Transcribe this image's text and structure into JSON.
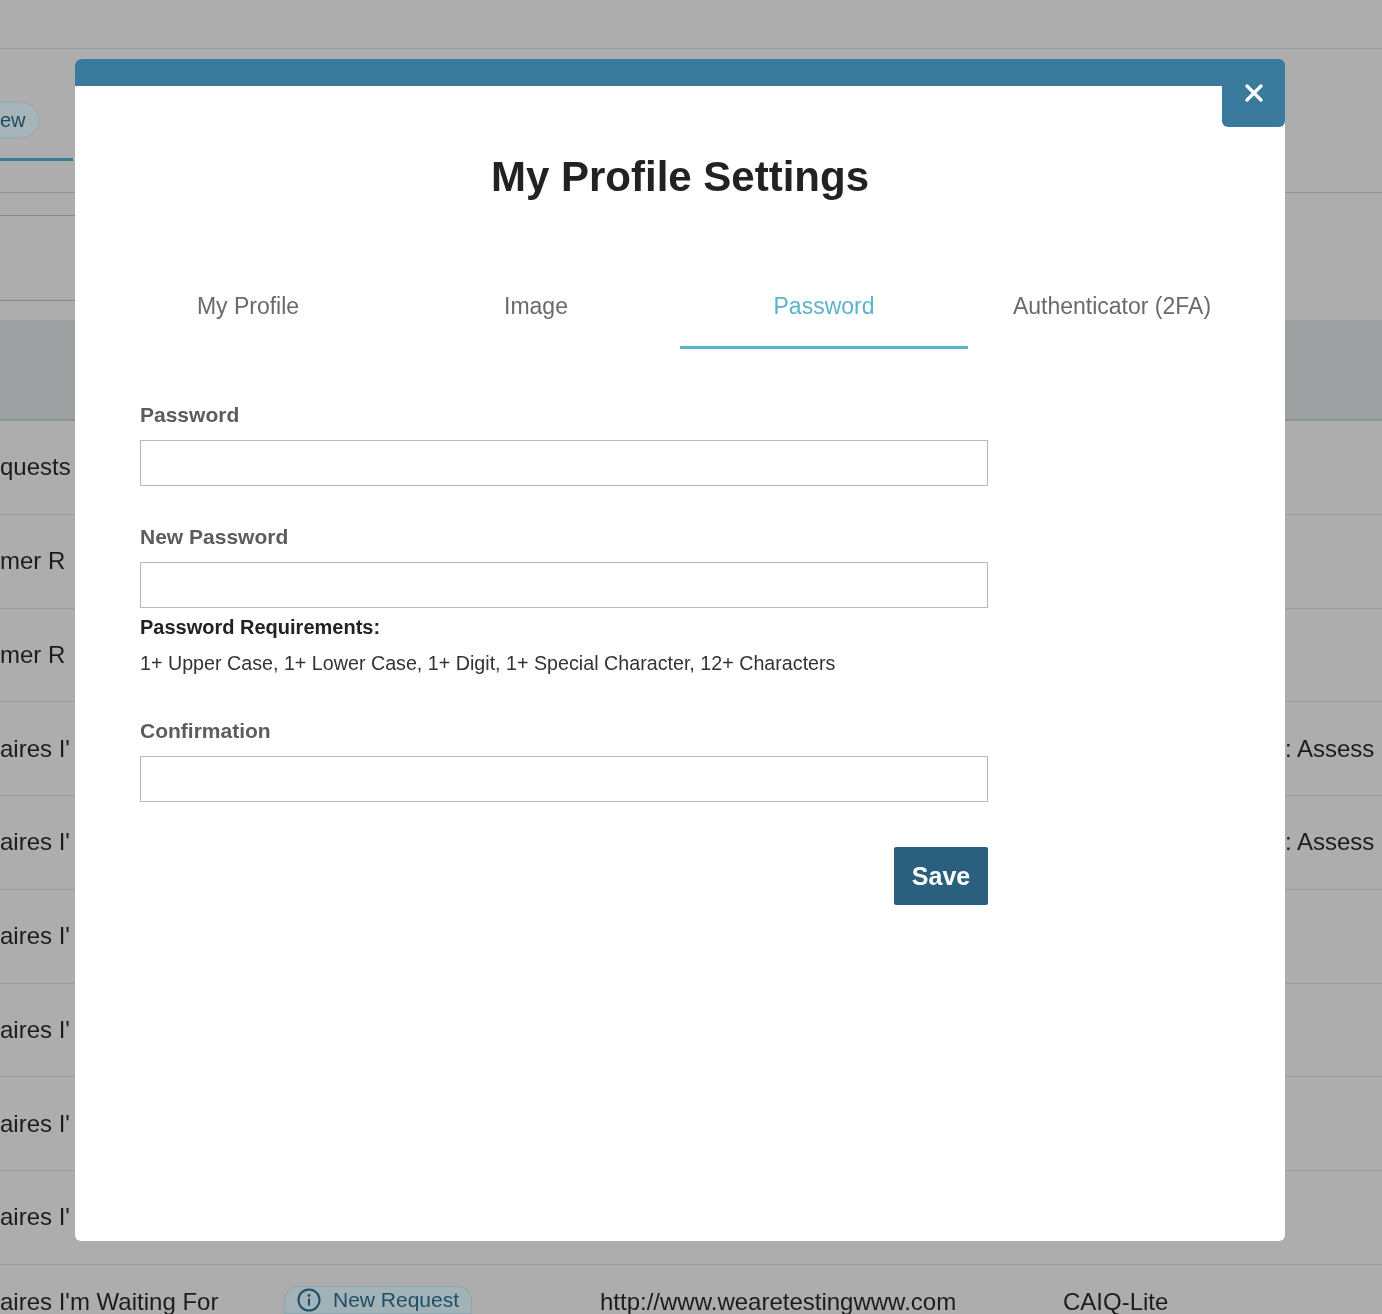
{
  "background": {
    "nav": {
      "pill": "ew"
    },
    "rows": [
      {
        "column_1": "quests"
      },
      {
        "column_1": "mer R"
      },
      {
        "column_1": "mer R"
      },
      {
        "column_1": "aires I'",
        "column_2": ": Assess"
      },
      {
        "column_1": "aires I'",
        "column_2": ": Assess"
      },
      {
        "column_1": "aires I'"
      },
      {
        "column_1": "aires I'"
      },
      {
        "column_1": "aires I'"
      },
      {
        "column_1": "aires I'"
      }
    ],
    "last_row": {
      "column_1": "aires I'm Waiting For",
      "status_badge": "New Request",
      "column_3": "http://www.wearetestingwww.com",
      "column_4": "CAIQ-Lite"
    }
  },
  "modal": {
    "title": "My Profile Settings",
    "tabs": [
      {
        "label": "My Profile",
        "selected": false
      },
      {
        "label": "Image",
        "selected": false
      },
      {
        "label": "Password",
        "selected": true
      },
      {
        "label": "Authenticator (2FA)",
        "selected": false
      }
    ],
    "form": {
      "fields": [
        {
          "label": "Password"
        },
        {
          "label": "New Password",
          "requirements": {
            "heading": "Password Requirements:",
            "text": "1+ Upper Case, 1+ Lower Case, 1+ Digit, 1+ Special Character, 12+ Characters"
          }
        },
        {
          "label": "Confirmation"
        }
      ],
      "save_button": "Save"
    }
  }
}
